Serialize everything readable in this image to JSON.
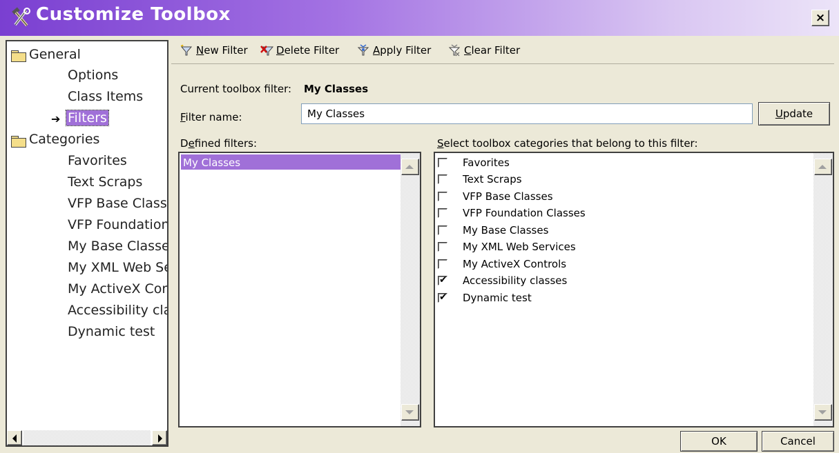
{
  "window": {
    "title": "Customize Toolbox",
    "close_label": "×",
    "colors": {
      "titlebar_start": "#7a3fd1",
      "titlebar_end": "#ece4f8",
      "selection": "#a070d8",
      "face": "#ece9d8"
    }
  },
  "tree": {
    "general": {
      "label": "General",
      "icon": "folder-icon",
      "children": [
        "Options",
        "Class Items",
        "Filters"
      ],
      "selected": "Filters",
      "selected_marker": "➔"
    },
    "categories": {
      "label": "Categories",
      "icon": "folder-icon",
      "children": [
        "Favorites",
        "Text Scraps",
        "VFP Base Classe",
        "VFP Foundation",
        "My Base Classes",
        "My XML Web Se",
        "My ActiveX Cor",
        "Accessibility clas",
        "Dynamic test"
      ]
    }
  },
  "toolbar": {
    "new_filter": {
      "pre": "",
      "key": "N",
      "post": "ew Filter",
      "icon": "new-filter-icon"
    },
    "delete_filter": {
      "pre": "",
      "key": "D",
      "post": "elete Filter",
      "icon": "delete-filter-icon"
    },
    "apply_filter": {
      "pre": "",
      "key": "A",
      "post": "pply Filter",
      "icon": "apply-filter-icon"
    },
    "clear_filter": {
      "pre": "",
      "key": "C",
      "post": "lear Filter",
      "icon": "clear-filter-icon"
    }
  },
  "form": {
    "current_filter_label": "Current toolbox filter:",
    "current_filter_value": "My Classes",
    "filter_name_label": {
      "key": "F",
      "rest": "ilter name:"
    },
    "filter_name_value": "My Classes",
    "update_button": {
      "key": "U",
      "rest": "pdate"
    },
    "defined_filters_label": {
      "pre": "D",
      "key": "e",
      "rest": "fined filters:"
    },
    "select_categories_label": {
      "key": "S",
      "rest": "elect toolbox categories that belong to this filter:"
    }
  },
  "defined_filters": [
    "My Classes"
  ],
  "categories": [
    {
      "label": "Favorites",
      "checked": false
    },
    {
      "label": "Text Scraps",
      "checked": false
    },
    {
      "label": "VFP Base Classes",
      "checked": false
    },
    {
      "label": "VFP Foundation Classes",
      "checked": false
    },
    {
      "label": "My Base Classes",
      "checked": false
    },
    {
      "label": "My XML Web Services",
      "checked": false
    },
    {
      "label": "My ActiveX Controls",
      "checked": false
    },
    {
      "label": "Accessibility classes",
      "checked": true
    },
    {
      "label": "Dynamic test",
      "checked": true
    }
  ],
  "check_mark": "✔",
  "buttons": {
    "ok": "OK",
    "cancel": "Cancel"
  }
}
